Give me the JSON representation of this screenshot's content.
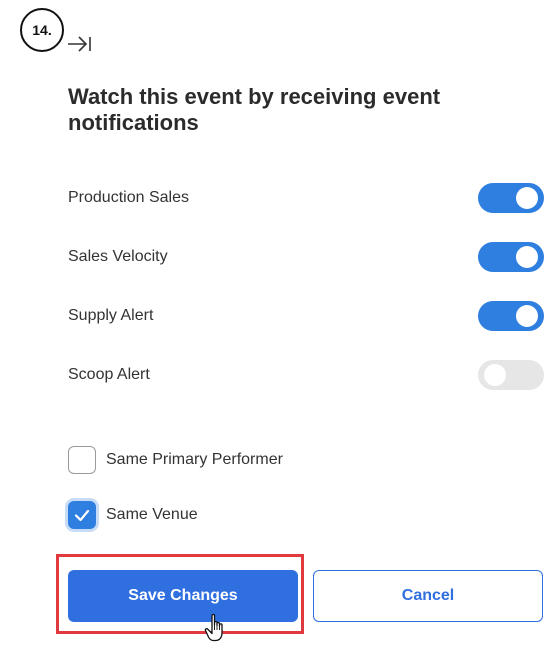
{
  "step": {
    "label": "14."
  },
  "panel": {
    "title": "Watch this event by receiving event notifications"
  },
  "toggles": [
    {
      "label": "Production Sales",
      "state": "on"
    },
    {
      "label": "Sales Velocity",
      "state": "on"
    },
    {
      "label": "Supply Alert",
      "state": "on"
    },
    {
      "label": "Scoop Alert",
      "state": "off"
    }
  ],
  "checkboxes": [
    {
      "label": "Same Primary Performer",
      "checked": false
    },
    {
      "label": "Same Venue",
      "checked": true
    }
  ],
  "buttons": {
    "save_label": "Save Changes",
    "cancel_label": "Cancel"
  },
  "colors": {
    "accent": "#2f7fe0",
    "primary_button": "#2f6fe0",
    "highlight_box": "#e0393e",
    "toggle_off": "#e6e6e6"
  },
  "icons": {
    "collapse": "collapse-panel-icon",
    "cursor": "hand-pointer-icon",
    "check": "checkmark-icon"
  }
}
